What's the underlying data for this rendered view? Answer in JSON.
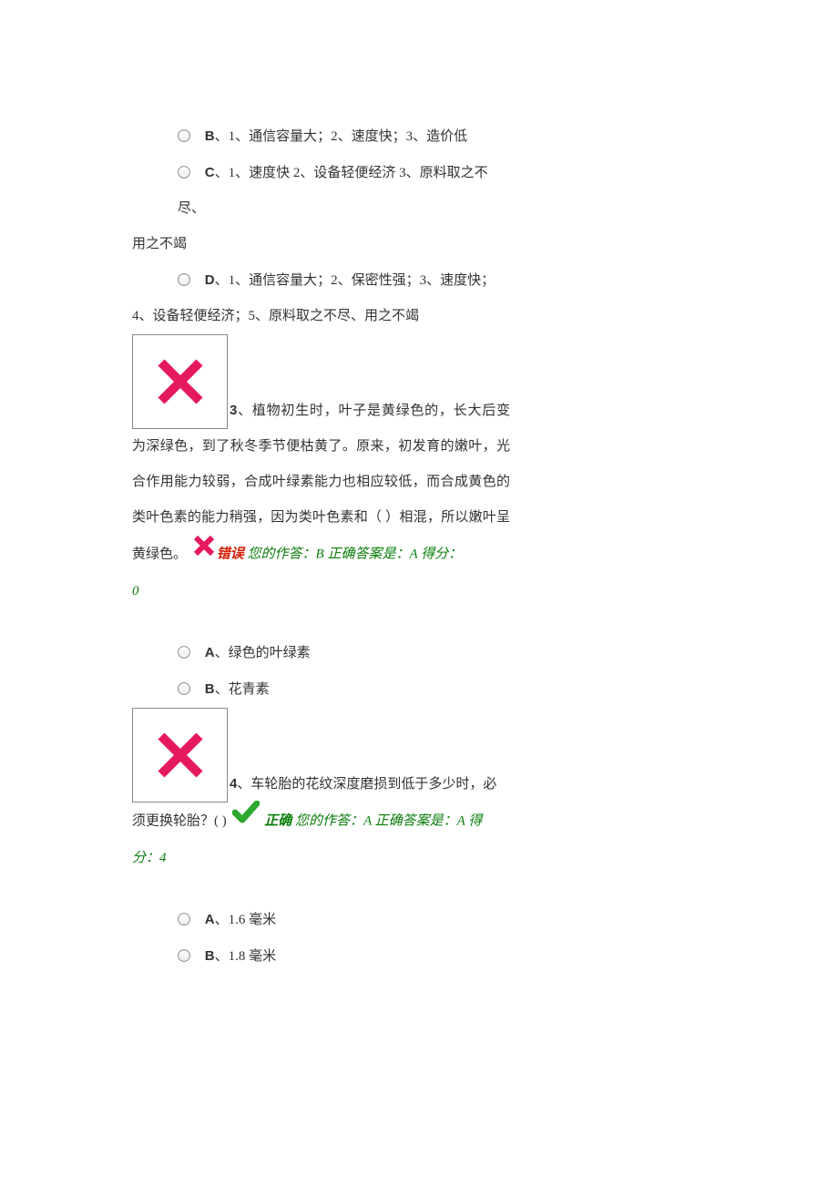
{
  "q2_opts": {
    "b": {
      "letter": "B",
      "text": "、1、通信容量大；2、速度快；3、造价低"
    },
    "c": {
      "letter": "C",
      "text": "、1、速度快 2、设备轻便经济 3、原料取之不尽、"
    },
    "c_tail": "用之不竭",
    "d": {
      "letter": "D",
      "text": "、1、通信容量大；2、保密性强；3、速度快；"
    },
    "d_tail": "4、设备轻便经济；5、原料取之不尽、用之不竭"
  },
  "q3": {
    "num": "3",
    "stem_a": "、植物初生时，叶子是黄绿色的，长大后变",
    "stem_b": "为深绿色，到了秋冬季节便枯黄了。原来，初发育的嫩叶，光合作用能力较弱，合成叶绿素能力也相应较低，而合成黄色的类叶色素的能力稍强，因为类叶色素和（ ）相混，所以嫩叶呈黄绿色。",
    "wrong": "错误",
    "fb_a": " 您的作答：B  正确答案是：A  得分：",
    "fb_b": "0",
    "opt_a": {
      "letter": "A",
      "text": "、绿色的叶绿素"
    },
    "opt_b": {
      "letter": "B",
      "text": "、花青素"
    }
  },
  "q4": {
    "num": "4",
    "stem_a": "、车轮胎的花纹深度磨损到低于多少时，必",
    "stem_b": "须更换轮胎？( )",
    "correct": "正确",
    "fb_a": " 您的作答：A  正确答案是：A  得",
    "fb_b": "分：4",
    "opt_a": {
      "letter": "A",
      "text": "、1.6 毫米"
    },
    "opt_b": {
      "letter": "B",
      "text": "、1.8 毫米"
    }
  }
}
